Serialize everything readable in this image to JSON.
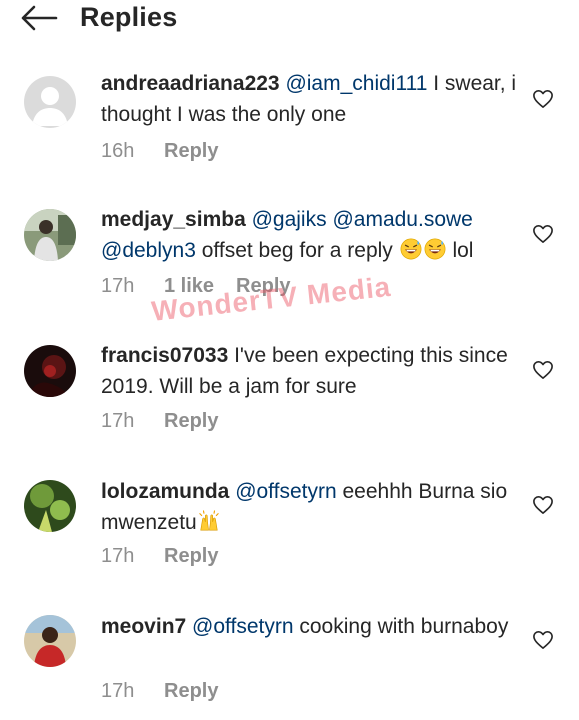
{
  "header": {
    "title": "Replies",
    "back_icon": "arrow-left-icon"
  },
  "watermark": "WonderTV Media",
  "comments": [
    {
      "username": "andreaadriana223",
      "mention": "@iam_chidi111",
      "text": " I swear, i thought I was the only one",
      "time": "16h",
      "reply_label": "Reply"
    },
    {
      "username": "medjay_simba",
      "mention": "@gajiks",
      "mention2": "@amadu.sowe",
      "mention3": "@deblyn3",
      "text": "  offset beg for a reply ",
      "emoji": "grinning-sweat-emoji",
      "text_after": " lol",
      "time": "17h",
      "likes": "1 like",
      "reply_label": "Reply"
    },
    {
      "username": "francis07033",
      "text": " I've been expecting this since 2019. Will be a jam for sure",
      "time": "17h",
      "reply_label": "Reply"
    },
    {
      "username": "lolozamunda",
      "mention": "@offsetyrn",
      "text": " eeehhh Burna sio mwenzetu",
      "emoji": "raising-hands-emoji",
      "time": "17h",
      "reply_label": "Reply"
    },
    {
      "username": "meovin7",
      "mention": "@offsetyrn",
      "text": " cooking with burnaboy",
      "time": "17h",
      "reply_label": "Reply"
    }
  ],
  "icons": {
    "like": "heart-outline-icon"
  },
  "colors": {
    "mention": "#00376b",
    "meta": "#8e8e8e",
    "text": "#262626",
    "watermark": "#eb505f"
  }
}
